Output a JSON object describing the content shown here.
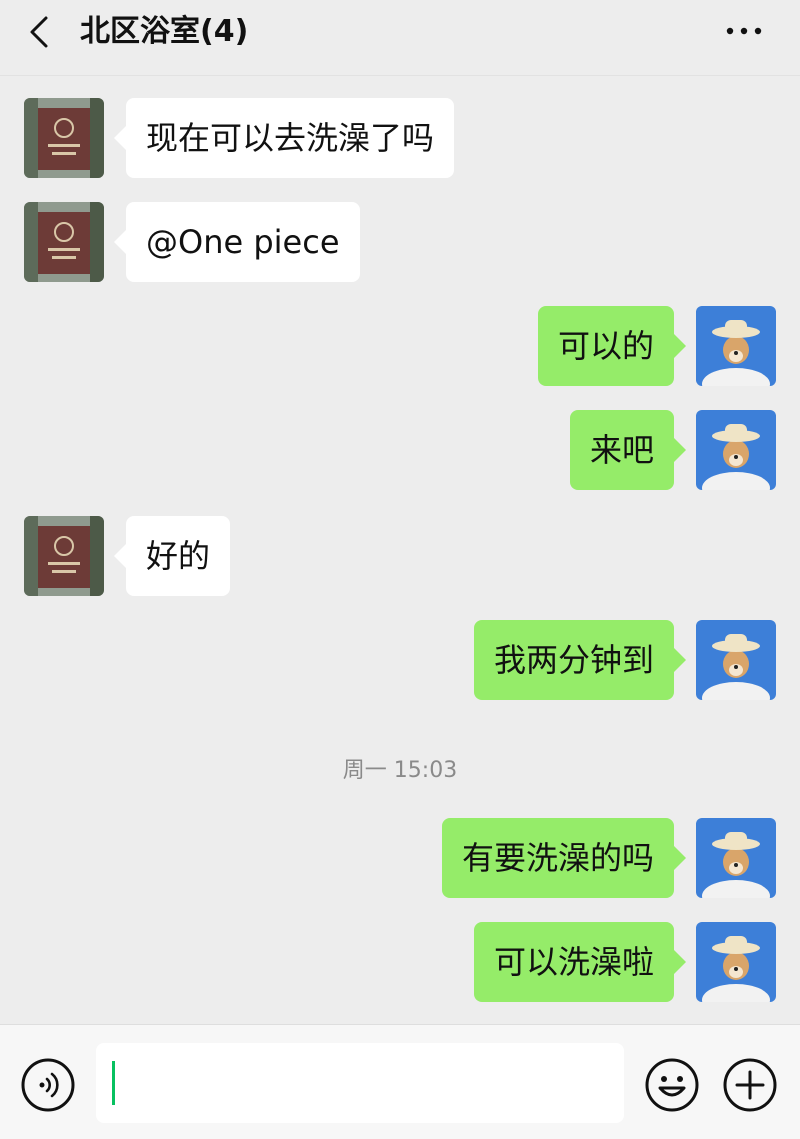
{
  "header": {
    "title": "北区浴室(4)",
    "back_icon": "chevron-left-icon",
    "more_icon": "more-dots-icon"
  },
  "messages": [
    {
      "side": "left",
      "text": "现在可以去洗澡了吗"
    },
    {
      "side": "left",
      "text": "@One piece"
    },
    {
      "side": "right",
      "text": "可以的"
    },
    {
      "side": "right",
      "text": "来吧"
    },
    {
      "side": "left",
      "text": "好的"
    },
    {
      "side": "right",
      "text": "我两分钟到"
    },
    {
      "side": "right",
      "text": "有要洗澡的吗"
    },
    {
      "side": "right",
      "text": "可以洗澡啦"
    }
  ],
  "timestamp": "周一 15:03",
  "input_bar": {
    "voice_icon": "voice-icon",
    "input_value": "",
    "emoji_icon": "emoji-icon",
    "plus_icon": "plus-icon"
  },
  "colors": {
    "background": "#ededed",
    "self_bubble": "#95ec69",
    "other_bubble": "#ffffff",
    "cursor": "#07c160"
  }
}
